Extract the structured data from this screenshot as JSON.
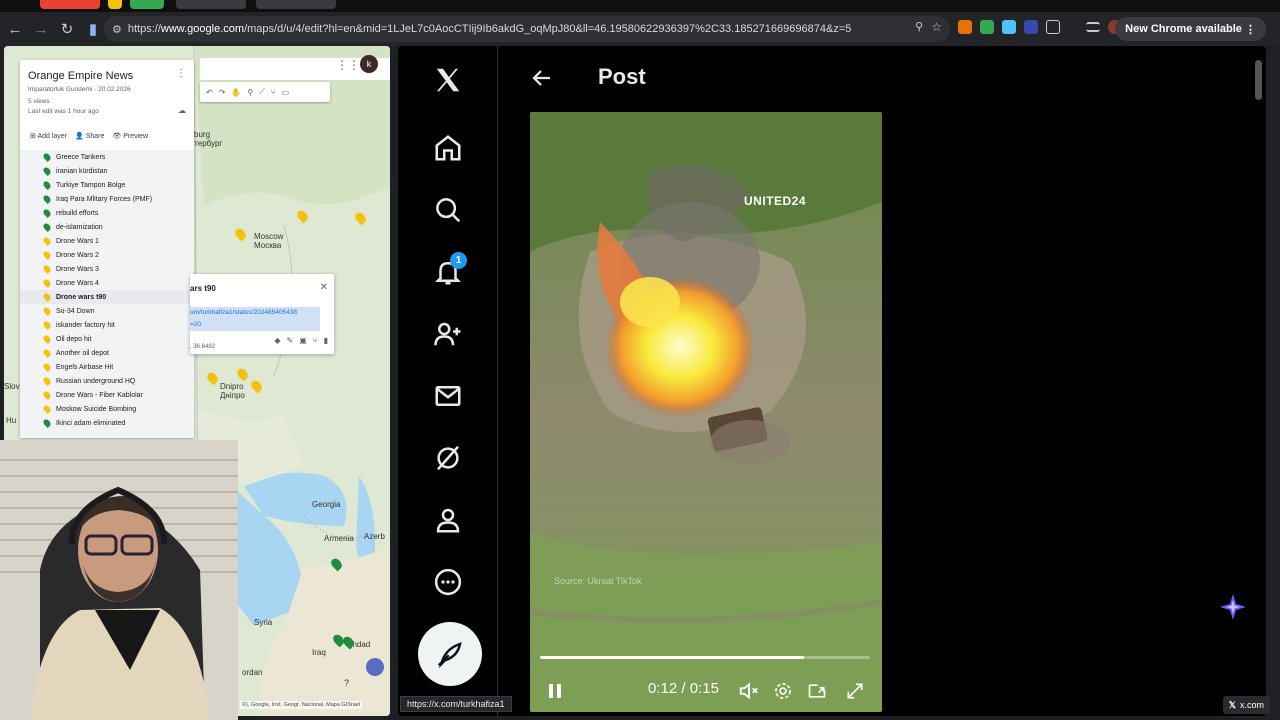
{
  "browser": {
    "url_prefix": "https://",
    "url_host": "www.google.com",
    "url_rest": "/maps/d/u/4/edit?hl=en&mid=1LJeL7c0AocCTIij9Ib6akdG_oqMpJ80&ll=46.19580622936397%2C33.18527166969687​4&z=5",
    "update_button": "New Chrome available",
    "status_url": "https://x.com/turkhafiza1",
    "site_chip": "x.com"
  },
  "maps": {
    "title": "Orange Empire News",
    "subtitle": "Imparatorluk Gundemi · 20.02.2026",
    "views": "5 views",
    "last_edit": "Last edit was 1 hour ago",
    "actions": [
      "Add layer",
      "Share",
      "Preview"
    ],
    "avatar_letter": "k",
    "layers": [
      {
        "label": "Greece Tankers",
        "color": "#1e8e3e"
      },
      {
        "label": "iranian kürdistan",
        "color": "#1e8e3e"
      },
      {
        "label": "Turkiye Tampon Bolge",
        "color": "#1e8e3e"
      },
      {
        "label": "Iraq Para Mlitary Forces (PMF)",
        "color": "#1e8e3e"
      },
      {
        "label": "rebuild efforts",
        "color": "#1e8e3e"
      },
      {
        "label": "de-islamization",
        "color": "#1e8e3e"
      },
      {
        "label": "Drone Wars 1",
        "color": "#f4c20d"
      },
      {
        "label": "Drone Wars 2",
        "color": "#f4c20d"
      },
      {
        "label": "Drone Wars 3",
        "color": "#f4c20d"
      },
      {
        "label": "Drone Wars 4",
        "color": "#f4c20d"
      },
      {
        "label": "Drone wars t90",
        "color": "#f4c20d"
      },
      {
        "label": "Su-34 Down",
        "color": "#f4c20d"
      },
      {
        "label": "iskander factory hit",
        "color": "#f4c20d"
      },
      {
        "label": "Oil depo hit",
        "color": "#f4c20d"
      },
      {
        "label": "Another oil depot",
        "color": "#f4c20d"
      },
      {
        "label": "Engels Airbase Hit",
        "color": "#f4c20d"
      },
      {
        "label": "Russian underground HQ",
        "color": "#f4c20d"
      },
      {
        "label": "Drone Wars - Fiber Kablolar",
        "color": "#f4c20d"
      },
      {
        "label": "Moskow Suicide Bombing",
        "color": "#f4c20d"
      },
      {
        "label": "Ikinci adam eliminated",
        "color": "#1e8e3e"
      }
    ],
    "selected_layer_index": 10,
    "labels": {
      "petersburg": "sburg\nетербург",
      "moscow": "Moscow\nМосква",
      "dnipro": "Dnipro\nДніпро",
      "georgia": "Georgia",
      "armenia": "Armenia",
      "azer": "Azerb",
      "syria": "Syria",
      "iraq": "Iraq",
      "jordan": "ordan",
      "baghdad": "ghdad",
      "slov": "Slov",
      "hu": "Hu"
    },
    "infocard": {
      "title": "ars t90",
      "link": "om/turkhafiza1/status/202485405438\n=20",
      "coord": ", 36.6482"
    },
    "attribution": "©), Google, Inst. Geogr. Nacional, Mapa GISrael"
  },
  "x": {
    "page_title": "Post",
    "notification_count": "1",
    "video": {
      "watermark": "UNITED24",
      "source": "Source: Ukrsat TikTok",
      "current": "0:12",
      "duration": "0:15",
      "progress": 0.8
    }
  },
  "colors": {
    "x_blue": "#1d9bf0",
    "maps_green": "#1e8e3e",
    "maps_yellow": "#f4c20d"
  }
}
